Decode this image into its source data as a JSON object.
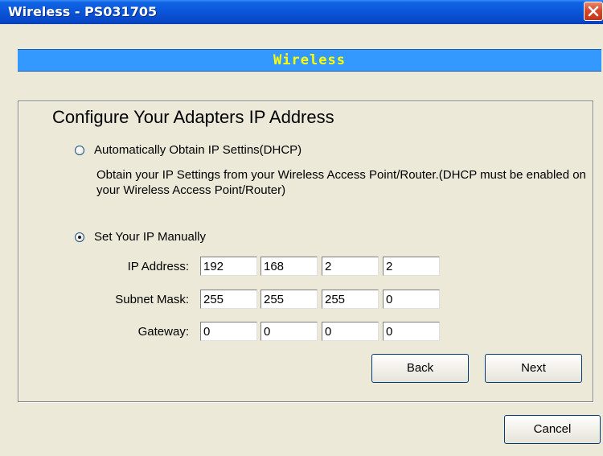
{
  "window": {
    "title": "Wireless - PS031705"
  },
  "header": {
    "text": "Wireless"
  },
  "section": {
    "heading": "Configure Your Adapters IP Address"
  },
  "options": {
    "dhcp": {
      "label": "Automatically Obtain IP Settins(DHCP)",
      "selected": false,
      "description": "Obtain your IP Settings from your Wireless Access Point/Router.(DHCP must be enabled on your Wireless Access Point/Router)"
    },
    "manual": {
      "label": "Set Your IP Manually",
      "selected": true
    }
  },
  "fields": {
    "ip_address": {
      "label": "IP Address:",
      "octets": [
        "192",
        "168",
        "2",
        "2"
      ]
    },
    "subnet_mask": {
      "label": "Subnet Mask:",
      "octets": [
        "255",
        "255",
        "255",
        "0"
      ]
    },
    "gateway": {
      "label": "Gateway:",
      "octets": [
        "0",
        "0",
        "0",
        "0"
      ]
    }
  },
  "buttons": {
    "back": "Back",
    "next": "Next",
    "cancel": "Cancel"
  },
  "colors": {
    "header_bg": "#3399ff",
    "header_text": "#ffff00",
    "title_bar": "#0a55d8",
    "close_button": "#d9482b"
  },
  "icons": {
    "close": "close-icon"
  }
}
